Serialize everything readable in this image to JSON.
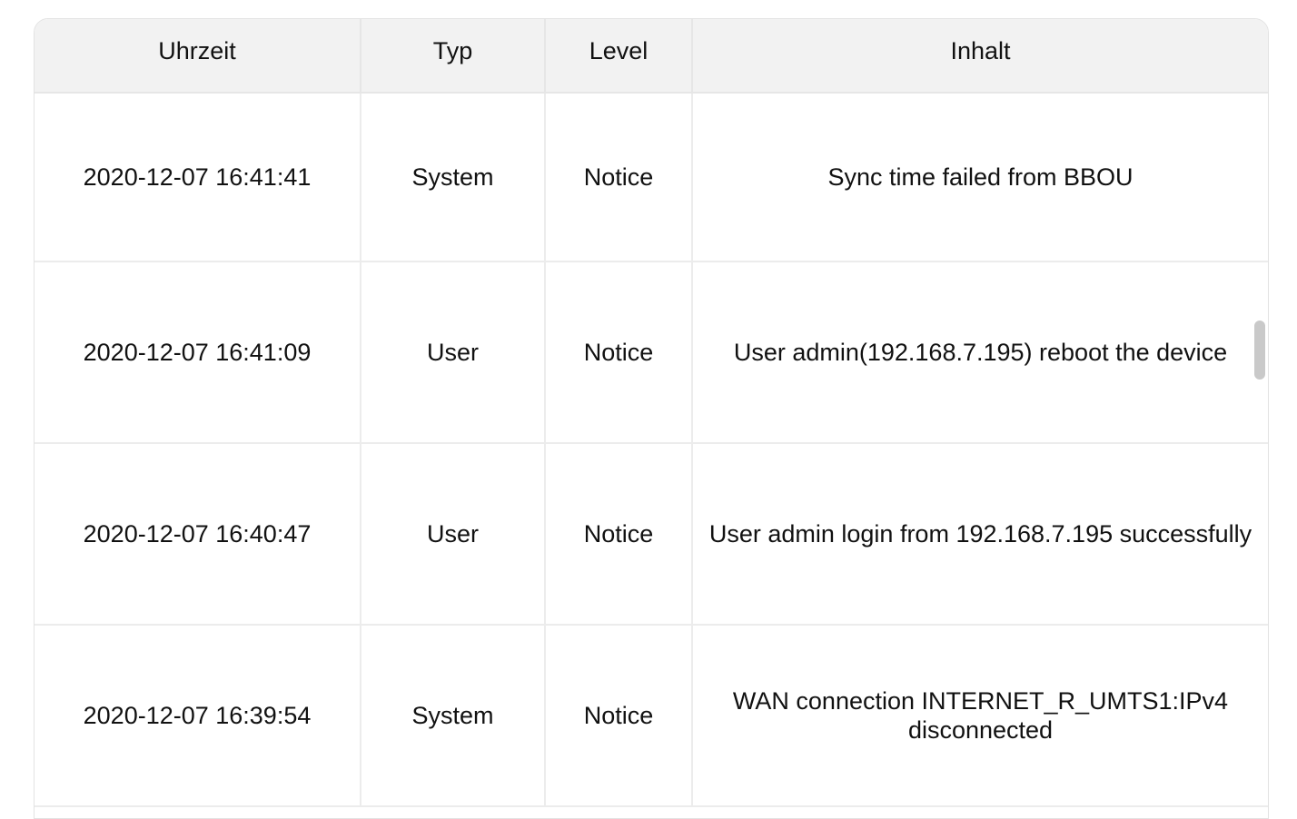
{
  "log_table": {
    "headers": {
      "time": "Uhrzeit",
      "type": "Typ",
      "level": "Level",
      "content": "Inhalt"
    },
    "rows": [
      {
        "time": "2020-12-07 16:41:41",
        "type": "System",
        "level": "Notice",
        "content": "Sync time failed from BBOU"
      },
      {
        "time": "2020-12-07 16:41:09",
        "type": "User",
        "level": "Notice",
        "content": "User admin(192.168.7.195) reboot the device"
      },
      {
        "time": "2020-12-07 16:40:47",
        "type": "User",
        "level": "Notice",
        "content": "User admin login from 192.168.7.195 successfully"
      },
      {
        "time": "2020-12-07 16:39:54",
        "type": "System",
        "level": "Notice",
        "content": "WAN connection INTERNET_R_UMTS1:IPv4 disconnected"
      }
    ]
  },
  "colors": {
    "header_bg": "#f2f2f2",
    "grid_line": "#ececec",
    "scrollbar": "#c9c9c9"
  }
}
